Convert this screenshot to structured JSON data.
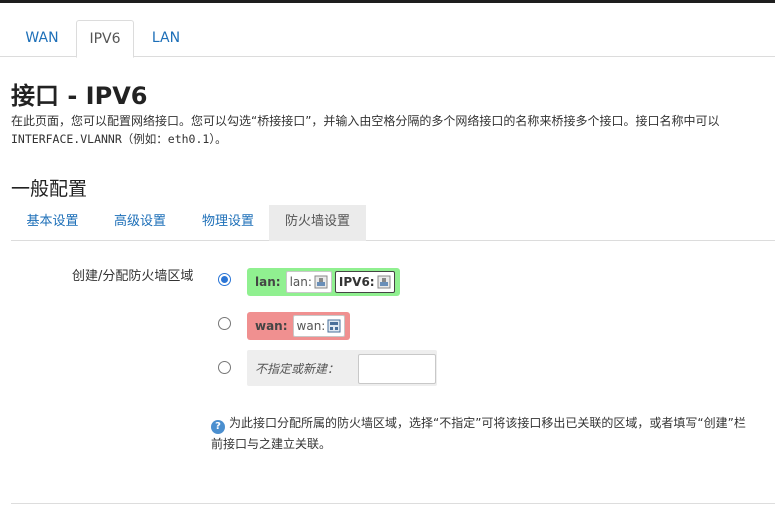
{
  "tabs": [
    {
      "label": "WAN"
    },
    {
      "label": "IPV6"
    },
    {
      "label": "LAN"
    }
  ],
  "page": {
    "title": "接口 - IPV6",
    "desc_line1": "在此页面，您可以配置网络接口。您可以勾选“桥接接口”，并输入由空格分隔的多个网络接口的名称来桥接多个接口。接口名称中可以",
    "desc_line2": "INTERFACE.VLANNR（例如：eth0.1）。"
  },
  "section": {
    "title": "一般配置",
    "subtabs": [
      {
        "label": "基本设置"
      },
      {
        "label": "高级设置"
      },
      {
        "label": "物理设置"
      },
      {
        "label": "防火墙设置"
      }
    ]
  },
  "firewall": {
    "field_label": "创建/分配防火墙区域",
    "zones": [
      {
        "name": "lan:",
        "color": "#90f090",
        "chips": [
          "lan:",
          "IPV6:"
        ],
        "selected": true
      },
      {
        "name": "wan:",
        "color": "#f09090",
        "chips": [
          "wan:"
        ],
        "selected": false
      }
    ],
    "new_zone_label": "不指定或新建：",
    "new_zone_value": "",
    "help_line1": "为此接口分配所属的防火墙区域，选择“不指定”可将该接口移出已关联的区域，或者填写“创建”栏",
    "help_line2": "前接口与之建立关联。"
  }
}
